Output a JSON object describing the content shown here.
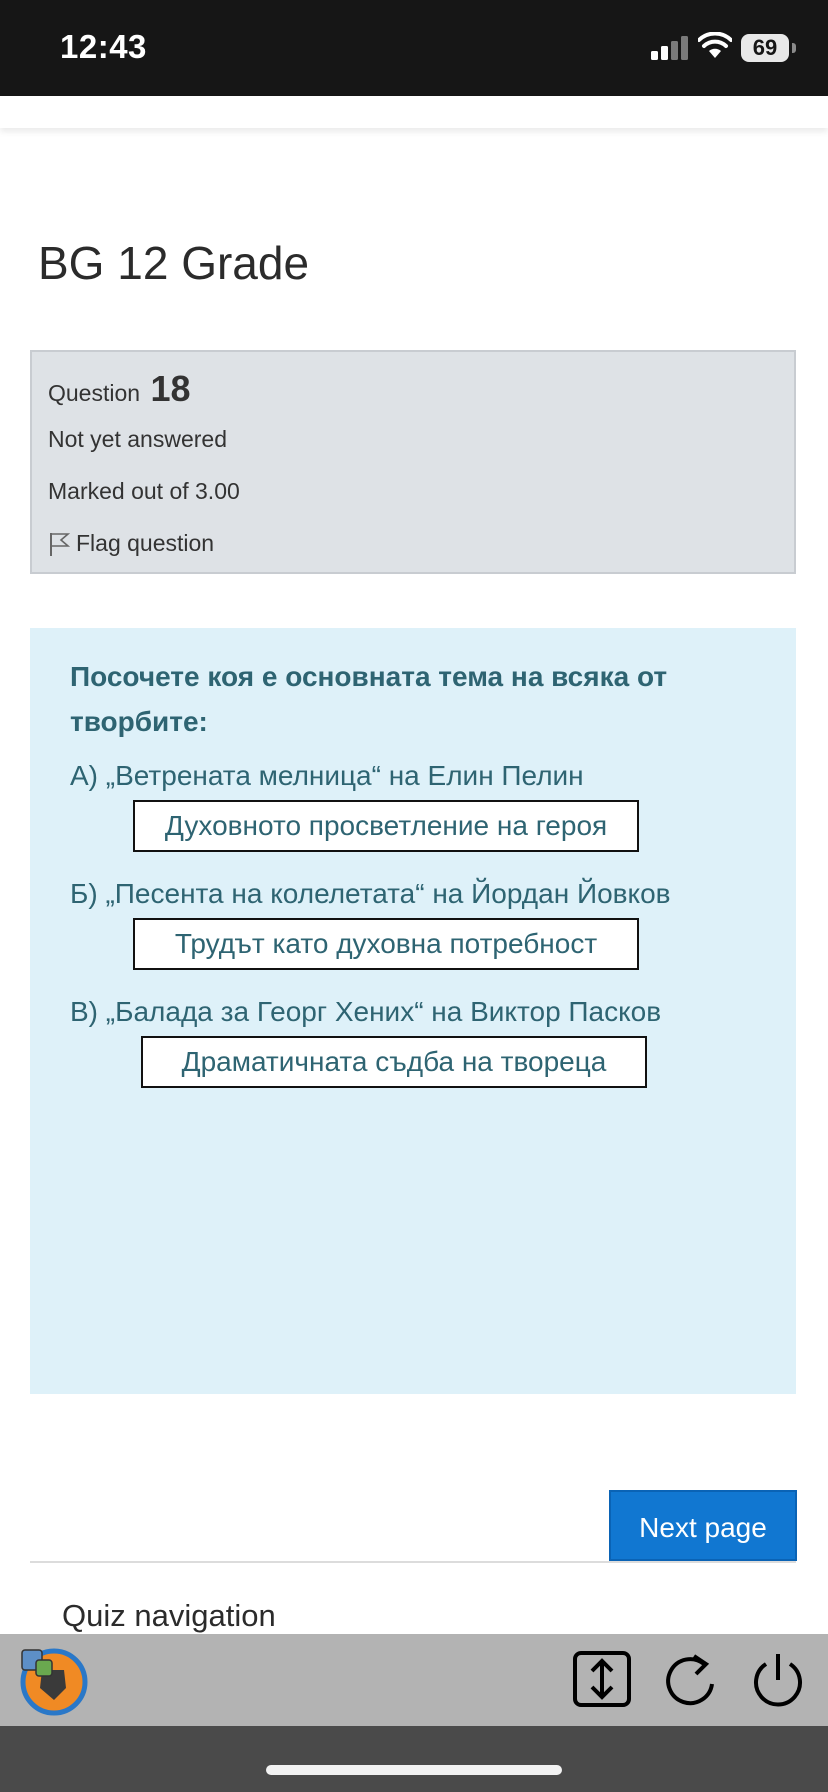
{
  "status": {
    "time": "12:43",
    "battery": "69"
  },
  "page": {
    "title": "BG 12 Grade"
  },
  "info": {
    "question_label": "Question",
    "question_number": "18",
    "state": "Not yet answered",
    "marked": "Marked out of 3.00",
    "flag": "Flag question"
  },
  "question": {
    "prompt": "Посочете коя е основната тема на всяка от творбите:",
    "items": [
      {
        "text": "А) „Ветрената мелница“ на Елин Пелин",
        "answer": "Духовното просветление на героя"
      },
      {
        "text": "Б) „Песента на колелетата“ на Йордан Йовков",
        "answer": "Трудът като духовна потребност"
      },
      {
        "text": "В) „Балада за Георг Хених“ на Виктор Пасков",
        "answer": "Драматичната съдба на твореца"
      }
    ]
  },
  "navigation": {
    "next_label": "Next page",
    "quiz_nav_label": "Quiz navigation"
  },
  "icons": [
    "signal-icon",
    "wifi-icon",
    "battery-icon",
    "flag-icon",
    "app-logo-icon",
    "scroll-icon",
    "reload-icon",
    "power-icon"
  ]
}
